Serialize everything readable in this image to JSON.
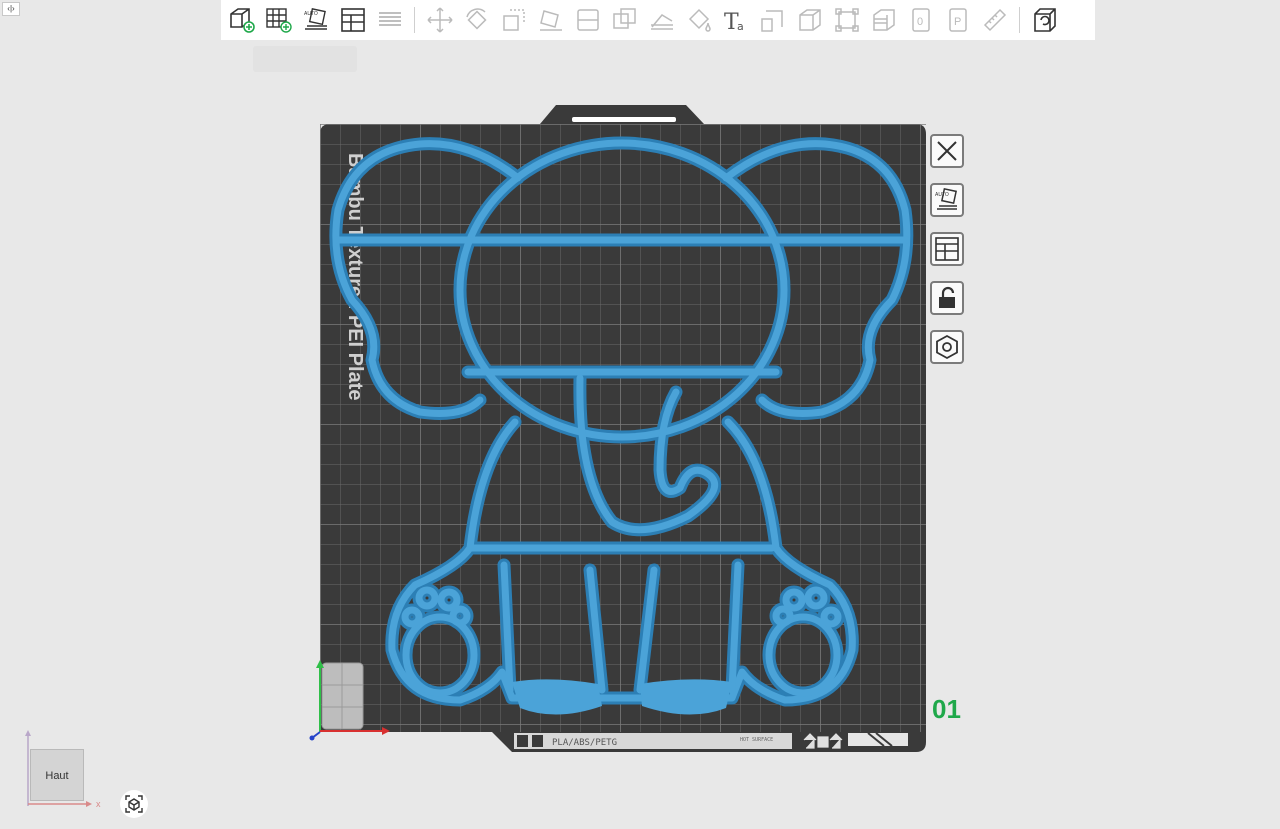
{
  "corner_toggle": {
    "label": "‹|›"
  },
  "toolbar": {
    "groups": [
      [
        "add-object-icon",
        "add-plate-icon",
        "auto-orient-icon",
        "arrange-icon",
        "split-layers-icon"
      ],
      [
        "move-icon",
        "rotate-icon",
        "scale-icon",
        "lay-on-face-icon",
        "split-icon",
        "boolean-icon",
        "cut-icon",
        "paint-bucket-icon",
        "text-icon",
        "support-paint-icon",
        "seam-paint-icon",
        "fuzzy-icon",
        "assembly-icon",
        "variable-layer-icon",
        "height-range-icon",
        "measure-icon"
      ],
      [
        "assembly-view-icon"
      ]
    ]
  },
  "plate": {
    "label": "Bambu Textured PEI Plate",
    "footer_material": "PLA/ABS/PETG",
    "footer_hot": "HOT\nSURFACE",
    "number": "01"
  },
  "side_toolbar": [
    "close-plate-icon",
    "auto-orient-plate-icon",
    "arrange-plate-icon",
    "lock-plate-icon",
    "plate-settings-icon"
  ],
  "view_cube": {
    "label": "Haut",
    "axis_x": "x"
  },
  "colors": {
    "object": "#4ba3d8",
    "plate": "#3a3a3a",
    "grid": "#5e5e5e",
    "plate_number": "#1fa84a"
  }
}
